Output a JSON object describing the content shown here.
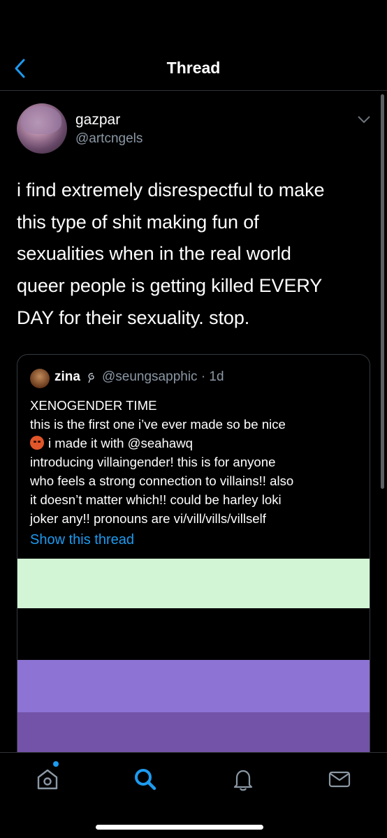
{
  "header": {
    "title": "Thread"
  },
  "tweet": {
    "display_name": "gazpar",
    "handle": "@artcngels",
    "lines": [
      "i find extremely disrespectful to make",
      "this type of shit making fun of",
      "sexualities when in the real world",
      "queer people is getting killed EVERY",
      "DAY for their sexuality. stop."
    ]
  },
  "quote": {
    "display_name": "zina",
    "handle": "@seungsapphic · 1d",
    "lines": [
      "XENOGENDER TIME",
      "this is the first one i’ve ever made so be nice",
      "i made it with @seahawq",
      "introducing villaingender! this is for anyone",
      "who feels a strong connection to villains!! also",
      "it doesn’t matter which!! could be harley loki",
      "joker any!! pronouns are vi/vill/vills/villself"
    ],
    "show_thread_label": "Show this thread",
    "flag_stripes": [
      "#d2f5d5",
      "#000000",
      "#8c73d4",
      "#7353a8"
    ]
  },
  "tab_bar": {
    "items": [
      "home-icon",
      "search-icon",
      "notifications-icon",
      "messages-icon"
    ],
    "active": "search-icon",
    "accent": "#1d9bf0"
  }
}
